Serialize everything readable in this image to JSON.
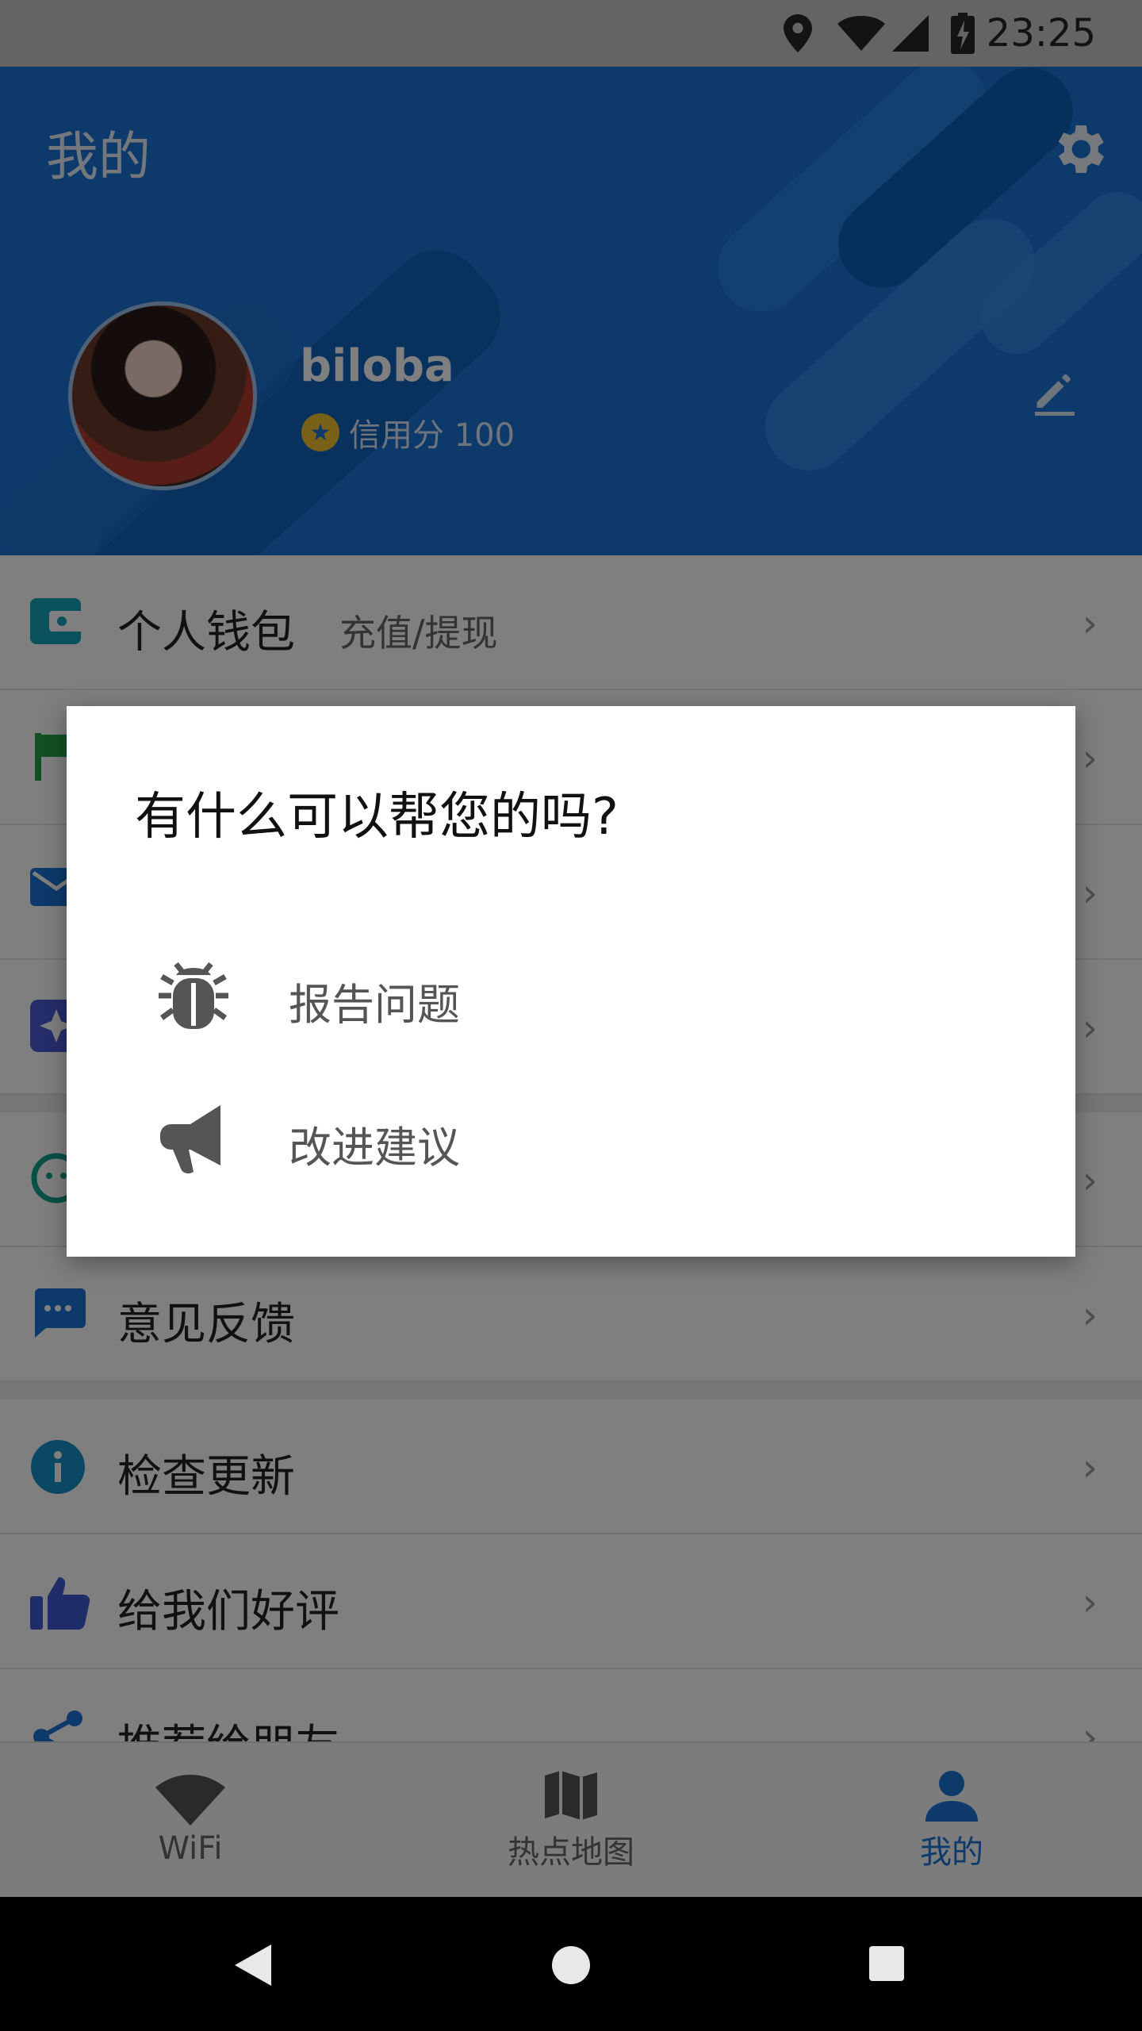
{
  "status_bar": {
    "time": "23:25"
  },
  "header": {
    "title": "我的",
    "username": "biloba",
    "credit_text": "信用分 100"
  },
  "menu": {
    "wallet": {
      "label": "个人钱包",
      "sub": "充值/提现"
    },
    "feedback": {
      "label": "意见反馈"
    },
    "check_update": {
      "label": "检查更新"
    },
    "rate_us": {
      "label": "给我们好评"
    },
    "recommend": {
      "label": "推荐给朋友"
    }
  },
  "bottom_nav": [
    {
      "label": "WiFi"
    },
    {
      "label": "热点地图"
    },
    {
      "label": "我的"
    }
  ],
  "dialog": {
    "title": "有什么可以帮您的吗?",
    "items": [
      {
        "label": "报告问题",
        "icon": "bug-icon"
      },
      {
        "label": "改进建议",
        "icon": "megaphone-icon"
      }
    ]
  },
  "colors": {
    "brand": "#1a74d6",
    "scrim": "rgba(0,0,0,0.5)"
  }
}
